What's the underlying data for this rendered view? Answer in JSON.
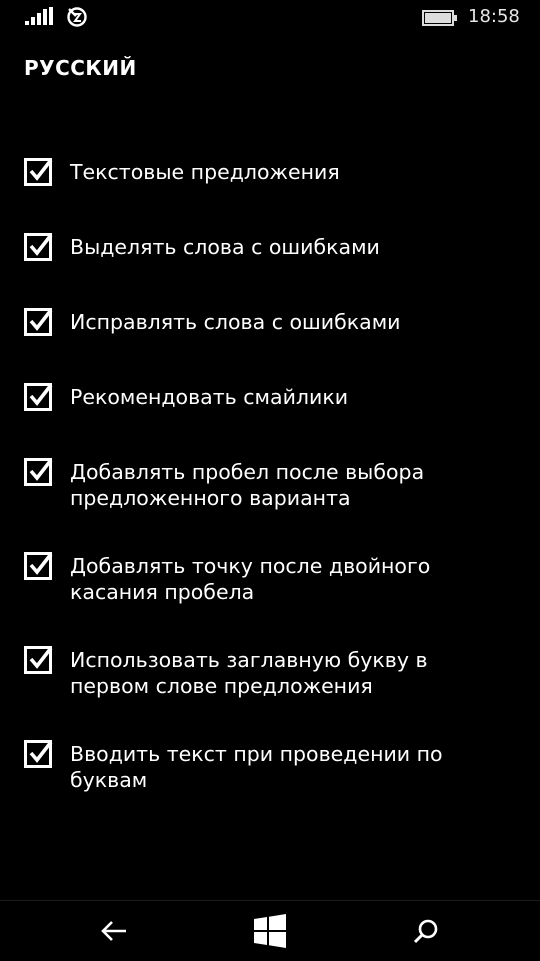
{
  "status_bar": {
    "time": "18:58",
    "signal_icon": "signal-bars-icon",
    "roaming_icon": "data-roaming-icon",
    "battery_icon": "battery-icon"
  },
  "header": {
    "title": "РУССКИЙ"
  },
  "options": [
    {
      "label": "Текстовые предложения",
      "checked": true
    },
    {
      "label": "Выделять слова с ошибками",
      "checked": true
    },
    {
      "label": "Исправлять слова с ошибками",
      "checked": true
    },
    {
      "label": "Рекомендовать смайлики",
      "checked": true
    },
    {
      "label": "Добавлять пробел после выбора\nпредложенного варианта",
      "checked": true
    },
    {
      "label": "Добавлять точку после двойного\nкасания пробела",
      "checked": true
    },
    {
      "label": "Использовать заглавную букву в\nпервом слове предложения",
      "checked": true
    },
    {
      "label": "Вводить текст при проведении по\nбуквам",
      "checked": true
    }
  ],
  "nav_bar": {
    "back_icon": "back-arrow-icon",
    "home_icon": "windows-logo-icon",
    "search_icon": "search-icon"
  }
}
